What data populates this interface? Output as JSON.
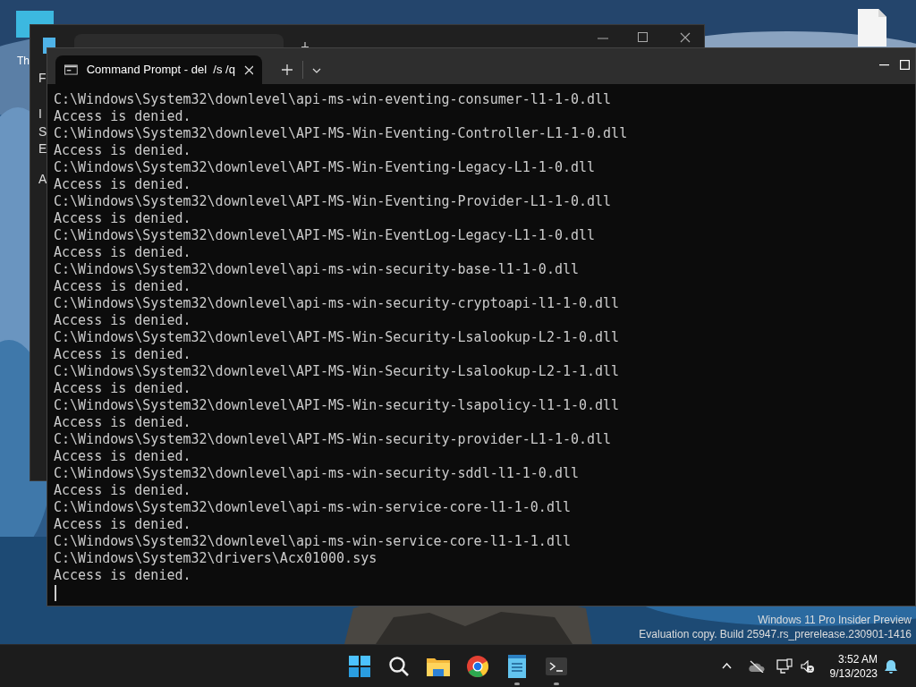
{
  "desktop_icons": [
    {
      "label": "Th"
    }
  ],
  "background_window": {
    "side_letters": [
      {
        "text": "F"
      },
      {
        "text": "I"
      },
      {
        "text": "S"
      },
      {
        "text": "E"
      },
      {
        "text": "A"
      }
    ]
  },
  "terminal": {
    "tab_title": "Command Prompt - del  /s /q",
    "lines": [
      "C:\\Windows\\System32\\downlevel\\api-ms-win-eventing-consumer-l1-1-0.dll",
      "Access is denied.",
      "C:\\Windows\\System32\\downlevel\\API-MS-Win-Eventing-Controller-L1-1-0.dll",
      "Access is denied.",
      "C:\\Windows\\System32\\downlevel\\API-MS-Win-Eventing-Legacy-L1-1-0.dll",
      "Access is denied.",
      "C:\\Windows\\System32\\downlevel\\API-MS-Win-Eventing-Provider-L1-1-0.dll",
      "Access is denied.",
      "C:\\Windows\\System32\\downlevel\\API-MS-Win-EventLog-Legacy-L1-1-0.dll",
      "Access is denied.",
      "C:\\Windows\\System32\\downlevel\\api-ms-win-security-base-l1-1-0.dll",
      "Access is denied.",
      "C:\\Windows\\System32\\downlevel\\api-ms-win-security-cryptoapi-l1-1-0.dll",
      "Access is denied.",
      "C:\\Windows\\System32\\downlevel\\API-MS-Win-Security-Lsalookup-L2-1-0.dll",
      "Access is denied.",
      "C:\\Windows\\System32\\downlevel\\API-MS-Win-Security-Lsalookup-L2-1-1.dll",
      "Access is denied.",
      "C:\\Windows\\System32\\downlevel\\API-MS-Win-security-lsapolicy-l1-1-0.dll",
      "Access is denied.",
      "C:\\Windows\\System32\\downlevel\\API-MS-Win-security-provider-L1-1-0.dll",
      "Access is denied.",
      "C:\\Windows\\System32\\downlevel\\api-ms-win-security-sddl-l1-1-0.dll",
      "Access is denied.",
      "C:\\Windows\\System32\\downlevel\\api-ms-win-service-core-l1-1-0.dll",
      "Access is denied.",
      "C:\\Windows\\System32\\downlevel\\api-ms-win-service-core-l1-1-1.dll",
      "C:\\Windows\\System32\\drivers\\Acx01000.sys",
      "Access is denied."
    ]
  },
  "evaluation_notice": [
    "Windows 11 Pro Insider Preview",
    "Evaluation copy. Build 25947.rs_prerelease.230901-1416"
  ],
  "taskbar": {
    "apps": [
      {
        "kind": "start",
        "running": false
      },
      {
        "kind": "search",
        "running": false
      },
      {
        "kind": "folder",
        "running": false
      },
      {
        "kind": "browser",
        "running": false
      },
      {
        "kind": "notepad",
        "running": true
      },
      {
        "kind": "terminal",
        "running": true
      }
    ],
    "clock": {
      "time": "3:52 AM",
      "date": "9/13/2023"
    }
  }
}
